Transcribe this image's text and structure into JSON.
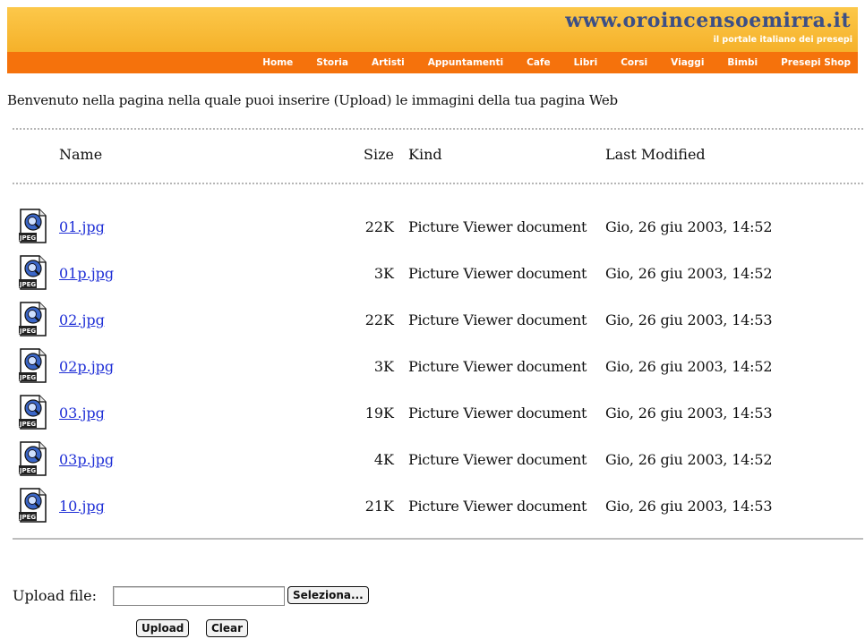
{
  "header": {
    "site_url": "www.oroincensoemirra.it",
    "site_subtitle": "il portale italiano dei presepi",
    "nav": [
      "Home",
      "Storia",
      "Artisti",
      "Appuntamenti",
      "Cafe",
      "Libri",
      "Corsi",
      "Viaggi",
      "Bimbi",
      "Presepi Shop"
    ]
  },
  "intro": "Benvenuto nella pagina nella quale puoi inserire (Upload) le immagini della tua pagina Web",
  "listing": {
    "columns": {
      "name": "Name",
      "size": "Size",
      "kind": "Kind",
      "modified": "Last Modified"
    },
    "files": [
      {
        "name": "01.jpg",
        "size": "22K",
        "kind": "Picture Viewer document",
        "modified": "Gio, 26 giu 2003, 14:52"
      },
      {
        "name": "01p.jpg",
        "size": "3K",
        "kind": "Picture Viewer document",
        "modified": "Gio, 26 giu 2003, 14:52"
      },
      {
        "name": "02.jpg",
        "size": "22K",
        "kind": "Picture Viewer document",
        "modified": "Gio, 26 giu 2003, 14:53"
      },
      {
        "name": "02p.jpg",
        "size": "3K",
        "kind": "Picture Viewer document",
        "modified": "Gio, 26 giu 2003, 14:52"
      },
      {
        "name": "03.jpg",
        "size": "19K",
        "kind": "Picture Viewer document",
        "modified": "Gio, 26 giu 2003, 14:53"
      },
      {
        "name": "03p.jpg",
        "size": "4K",
        "kind": "Picture Viewer document",
        "modified": "Gio, 26 giu 2003, 14:52"
      },
      {
        "name": "10.jpg",
        "size": "21K",
        "kind": "Picture Viewer document",
        "modified": "Gio, 26 giu 2003, 14:53"
      }
    ],
    "file_icon": "jpeg-document-icon"
  },
  "upload": {
    "label": "Upload file:",
    "file_value": "",
    "browse_label": "Seleziona...",
    "upload_label": "Upload",
    "clear_label": "Clear"
  },
  "colors": {
    "banner": "#f7b731",
    "navbar": "#f5720c",
    "url_text": "#3c4f86",
    "link": "#1f2fd6"
  }
}
